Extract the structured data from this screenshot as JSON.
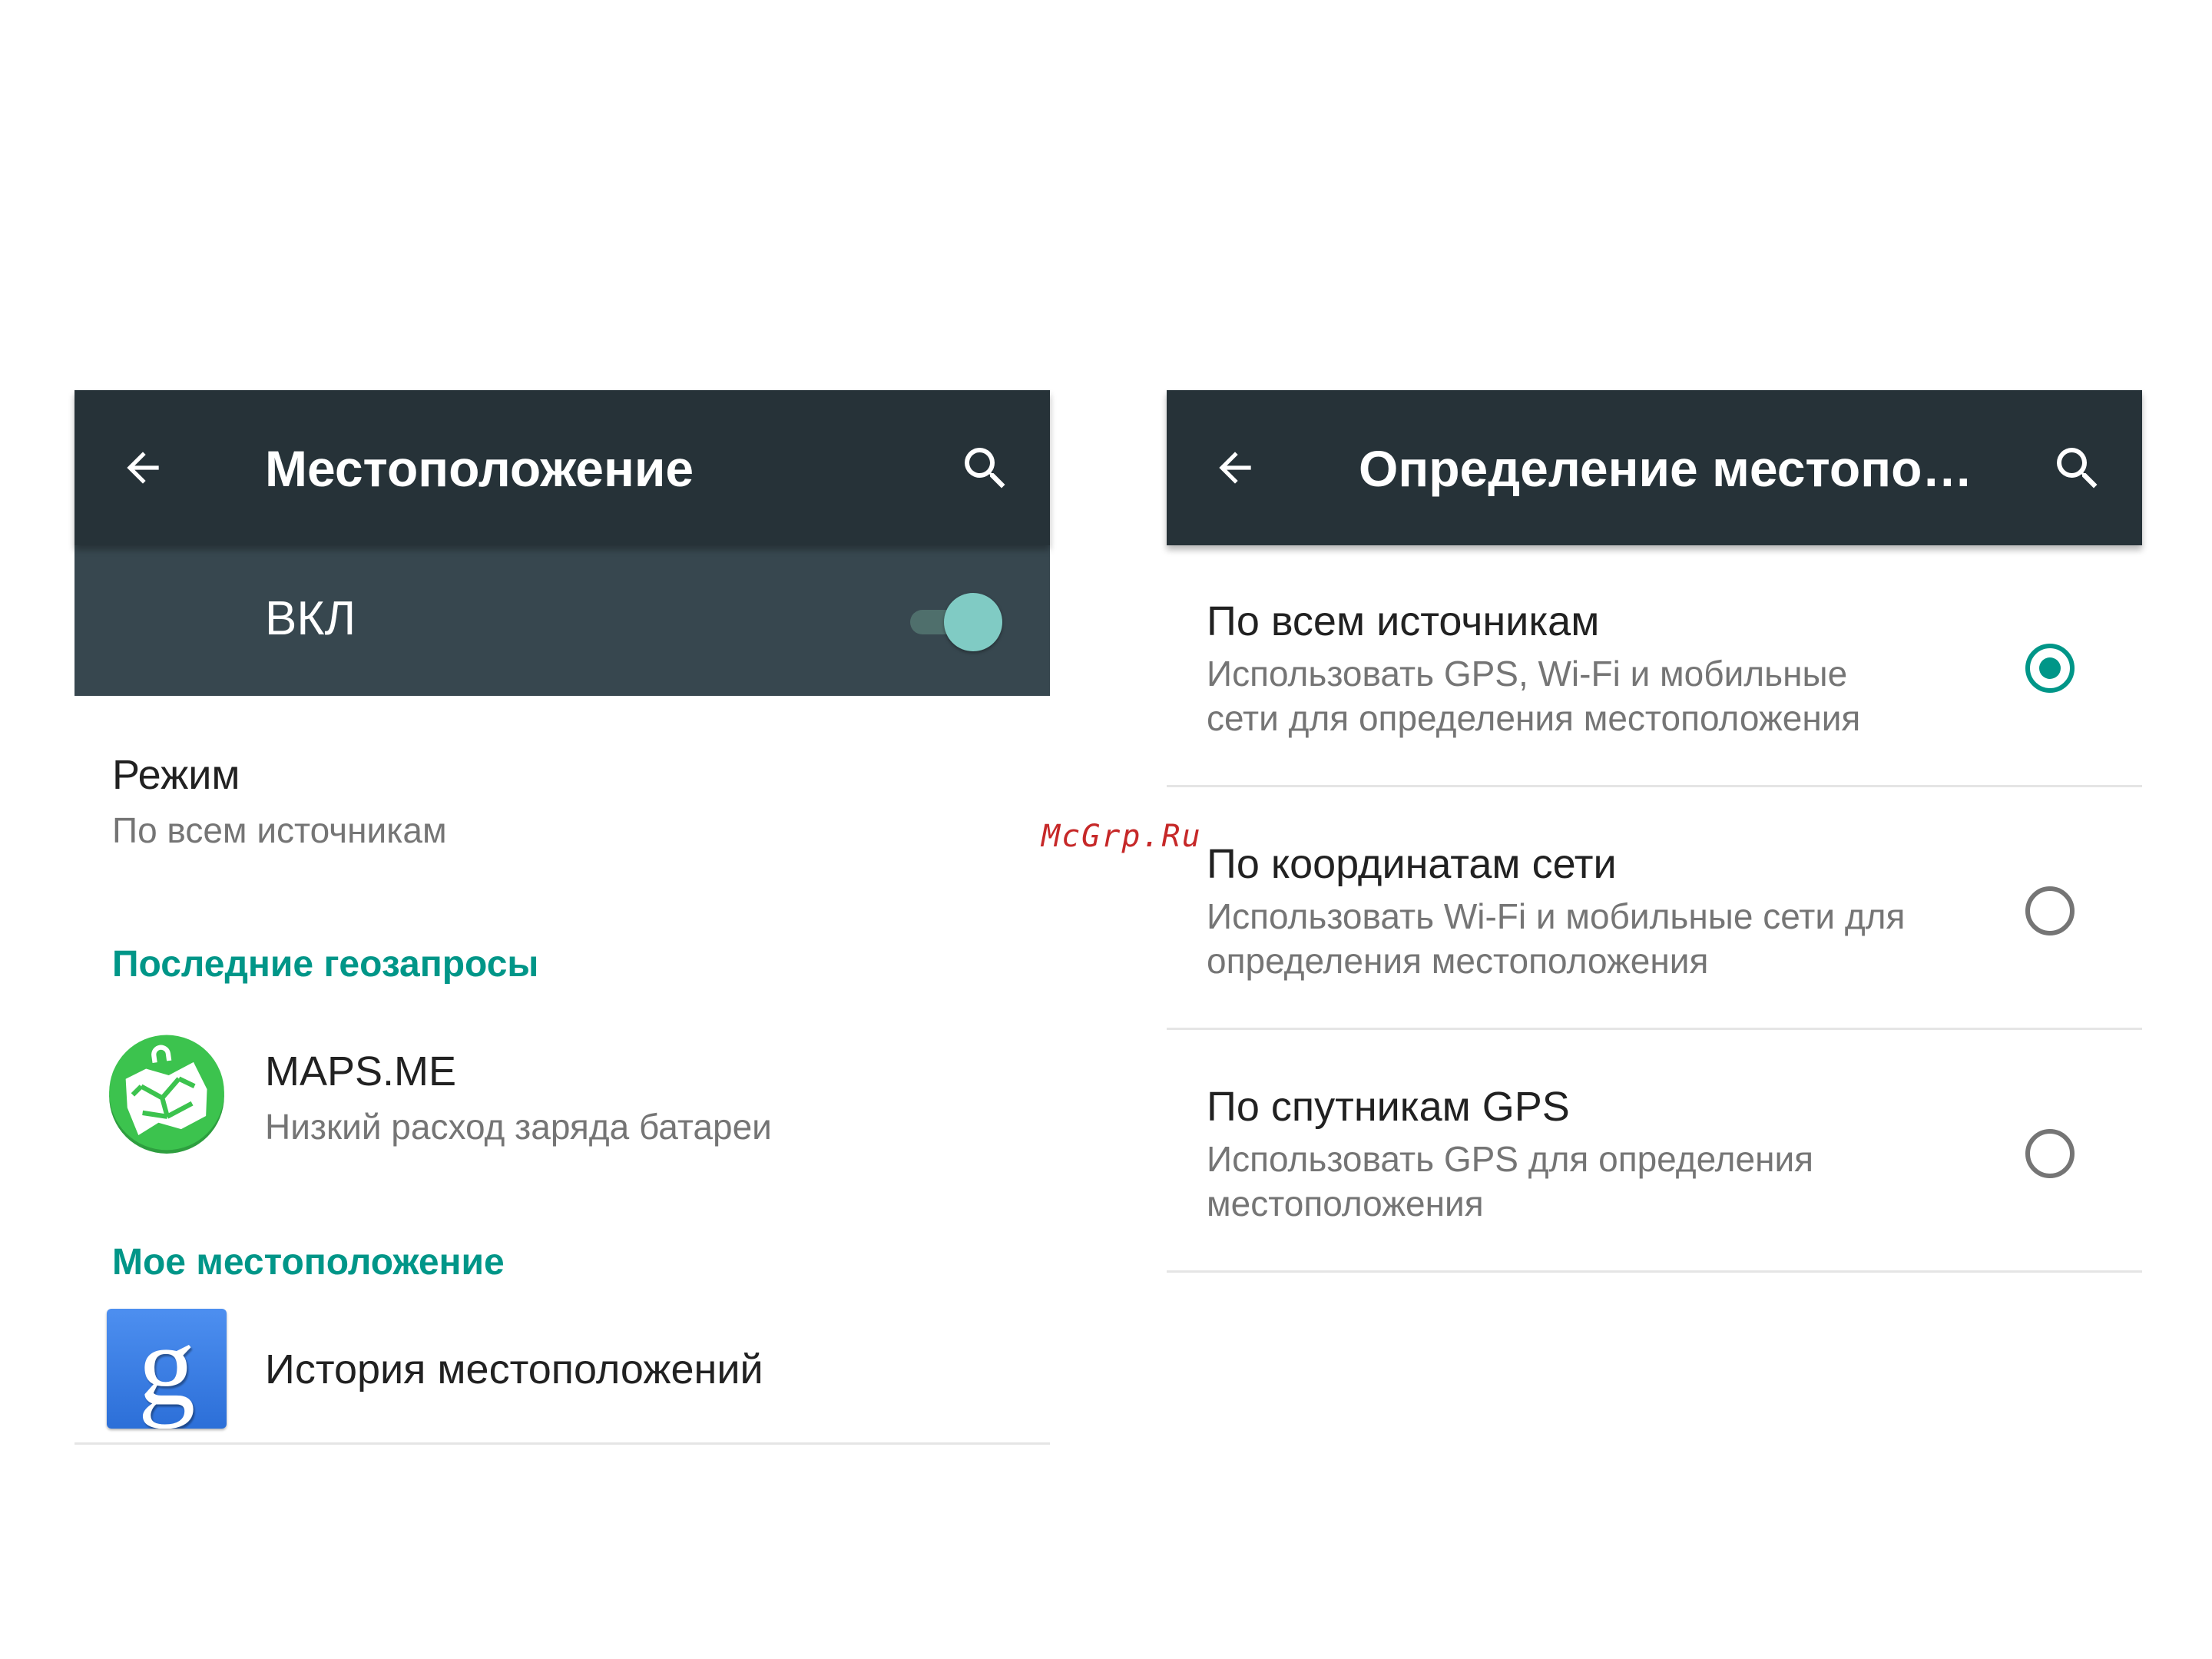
{
  "left_screen": {
    "toolbar": {
      "title": "Местоположение",
      "back_icon": "arrow-back-icon",
      "search_icon": "search-icon"
    },
    "master_switch": {
      "label": "ВКЛ",
      "state": "on"
    },
    "mode": {
      "title": "Режим",
      "summary": "По всем источникам"
    },
    "recent_requests": {
      "header": "Последние геозапросы",
      "items": [
        {
          "app": "MAPS.ME",
          "usage": "Низкий расход заряда батареи",
          "icon": "maps-me-icon"
        }
      ]
    },
    "my_location": {
      "header": "Мое местоположение",
      "items": [
        {
          "title": "История местоположений",
          "icon": "google-settings-icon"
        }
      ]
    }
  },
  "right_screen": {
    "toolbar": {
      "title": "Определение местопо…",
      "back_icon": "arrow-back-icon",
      "search_icon": "search-icon"
    },
    "options": [
      {
        "title": "По всем источникам",
        "line1": "Использовать GPS, Wi-Fi и мобильные",
        "line2": "сети для определения местоположения",
        "selected": true
      },
      {
        "title": "По координатам сети",
        "line1": "Использовать Wi-Fi и мобильные сети для",
        "line2": "определения местоположения",
        "selected": false
      },
      {
        "title": "По спутникам GPS",
        "line1": "Использовать GPS для определения",
        "line2": "местоположения",
        "selected": false
      }
    ]
  },
  "watermark": "McGrp.Ru",
  "colors": {
    "toolbar": "#263238",
    "switchbar": "#37474f",
    "accent": "#009688"
  }
}
